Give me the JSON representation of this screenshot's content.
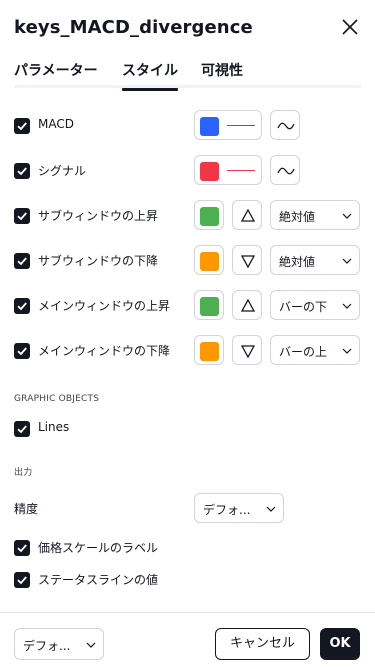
{
  "dialog": {
    "title": "keys_MACD_divergence"
  },
  "tabs": [
    {
      "label": "パラメーター",
      "active": false
    },
    {
      "label": "スタイル",
      "active": true
    },
    {
      "label": "可視性",
      "active": false
    }
  ],
  "style_rows": [
    {
      "label": "MACD",
      "checked": true,
      "color": "#2962ff",
      "line_color": "#2962ff",
      "control": "line-style"
    },
    {
      "label": "シグナル",
      "checked": true,
      "color": "#f23645",
      "line_color": "#f23645",
      "control": "line-style"
    },
    {
      "label": "サブウィンドウの上昇",
      "checked": true,
      "color": "#4caf50",
      "shape": "triangle-up",
      "position": "絶対値"
    },
    {
      "label": "サブウィンドウの下降",
      "checked": true,
      "color": "#ff9800",
      "shape": "triangle-down",
      "position": "絶対値"
    },
    {
      "label": "メインウィンドウの上昇",
      "checked": true,
      "color": "#4caf50",
      "shape": "triangle-up",
      "position": "バーの下"
    },
    {
      "label": "メインウィンドウの下降",
      "checked": true,
      "color": "#ff9800",
      "shape": "triangle-down",
      "position": "バーの上"
    }
  ],
  "graphic_objects": {
    "section_title": "GRAPHIC OBJECTS",
    "lines_label": "Lines",
    "lines_checked": true
  },
  "output": {
    "section_title": "出力",
    "precision_label": "精度",
    "precision_value": "デフォ...",
    "price_scale_label": "価格スケールのラベル",
    "price_scale_checked": true,
    "status_line_label": "ステータスラインの値",
    "status_line_checked": true
  },
  "footer": {
    "defaults_value": "デフォ...",
    "cancel_label": "キャンセル",
    "ok_label": "OK"
  }
}
